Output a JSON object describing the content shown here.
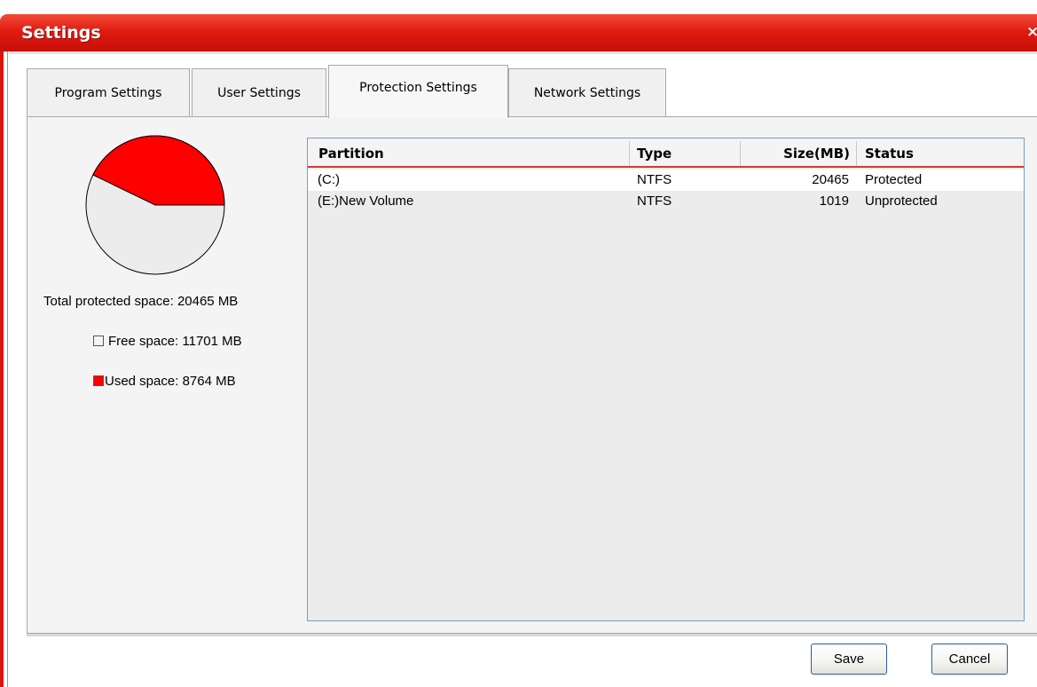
{
  "window": {
    "title": "Settings",
    "close_glyph": "×"
  },
  "tabs": [
    {
      "label": "Program Settings",
      "active": false
    },
    {
      "label": "User Settings",
      "active": false
    },
    {
      "label": "Protection Settings",
      "active": true
    },
    {
      "label": "Network Settings",
      "active": false
    }
  ],
  "disk_usage": {
    "total_label": "Total protected space:",
    "total_value": "20465 MB",
    "free_label": "Free space:",
    "free_value": "11701 MB",
    "used_label": "Used space:",
    "used_value": "8764 MB",
    "free_mb": 11701,
    "used_mb": 8764,
    "free_color": "#ececec",
    "used_color": "#ff0000"
  },
  "partitions": {
    "columns": [
      "Partition",
      "Type",
      "Size(MB)",
      "Status"
    ],
    "rows": [
      {
        "partition": "(C:)",
        "type": "NTFS",
        "size": "20465",
        "status": "Protected",
        "selected": true
      },
      {
        "partition": "(E:)New Volume",
        "type": "NTFS",
        "size": "1019",
        "status": "Unprotected",
        "selected": false
      }
    ]
  },
  "buttons": {
    "save": "Save",
    "cancel": "Cancel"
  },
  "colors": {
    "title_bar": "#e01c12",
    "header_underline": "#d33a32",
    "grid_border": "#7a9cc8"
  }
}
